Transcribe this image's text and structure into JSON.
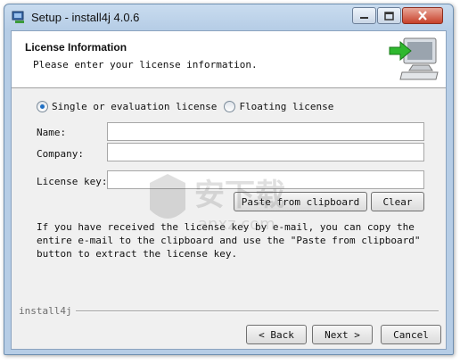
{
  "window": {
    "title": "Setup - install4j 4.0.6"
  },
  "header": {
    "title": "License Information",
    "subtitle": "Please enter your license information."
  },
  "license_type": {
    "options": [
      {
        "label": "Single or evaluation license",
        "selected": true
      },
      {
        "label": "Floating license",
        "selected": false
      }
    ]
  },
  "fields": {
    "name": {
      "label": "Name:",
      "value": ""
    },
    "company": {
      "label": "Company:",
      "value": ""
    },
    "license_key": {
      "label": "License key:",
      "value": ""
    }
  },
  "buttons": {
    "paste": "Paste from clipboard",
    "clear": "Clear",
    "back": "< Back",
    "next": "Next >",
    "cancel": "Cancel"
  },
  "info_text": "If you have received the license key by e-mail, you can copy the entire e-mail to the clipboard and use the \"Paste from clipboard\" button to extract the license key.",
  "footer": {
    "brand": "install4j"
  },
  "watermark": {
    "text": "安下载",
    "domain": "anxz.com"
  },
  "colors": {
    "accent": "#1f6fc4",
    "close_button": "#c7412a",
    "arrow_green": "#2fb82f"
  }
}
